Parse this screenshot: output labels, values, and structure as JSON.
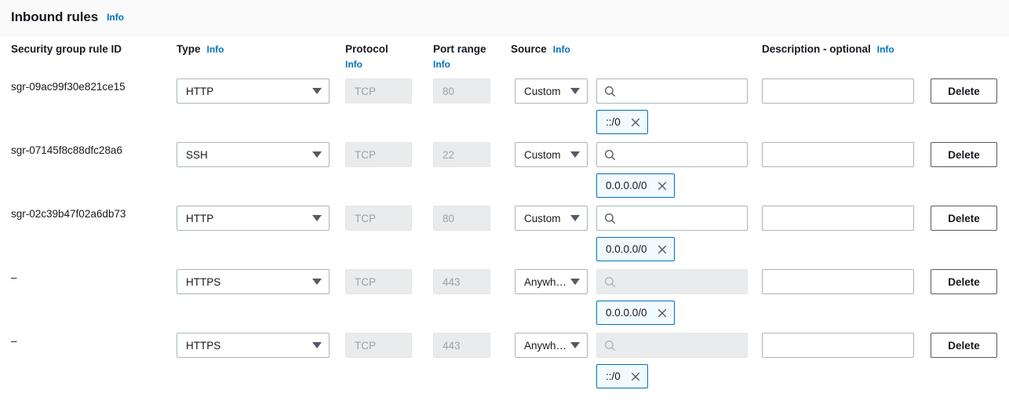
{
  "panel": {
    "title": "Inbound rules",
    "info_label": "Info"
  },
  "columns": {
    "rule_id": "Security group rule ID",
    "type": "Type",
    "type_info": "Info",
    "protocol": "Protocol",
    "protocol_info": "Info",
    "port_range": "Port range",
    "port_range_info": "Info",
    "source": "Source",
    "source_info": "Info",
    "description": "Description - optional",
    "description_info": "Info"
  },
  "icons": {
    "search": "search-icon",
    "close": "close-icon",
    "caret": "chevron-down-icon"
  },
  "colors": {
    "link": "#0073bb",
    "chip_border": "#0073bb",
    "chip_background": "#f1faff",
    "header_background": "#fafafa",
    "disabled_background": "#e9ebed",
    "border": "#aab7b8",
    "text": "#16191f"
  },
  "delete_label": "Delete",
  "rows": [
    {
      "rule_id": "sgr-09ac99f30e821ce15",
      "type": "HTTP",
      "protocol": "TCP",
      "port_range": "80",
      "source_type": "Custom",
      "source_disabled": false,
      "source_value": "",
      "source_token": "::/0",
      "description": ""
    },
    {
      "rule_id": "sgr-07145f8c88dfc28a6",
      "type": "SSH",
      "protocol": "TCP",
      "port_range": "22",
      "source_type": "Custom",
      "source_disabled": false,
      "source_value": "",
      "source_token": "0.0.0.0/0",
      "description": ""
    },
    {
      "rule_id": "sgr-02c39b47f02a6db73",
      "type": "HTTP",
      "protocol": "TCP",
      "port_range": "80",
      "source_type": "Custom",
      "source_disabled": false,
      "source_value": "",
      "source_token": "0.0.0.0/0",
      "description": ""
    },
    {
      "rule_id": "–",
      "type": "HTTPS",
      "protocol": "TCP",
      "port_range": "443",
      "source_type": "Anywh…",
      "source_disabled": true,
      "source_value": "",
      "source_token": "0.0.0.0/0",
      "description": ""
    },
    {
      "rule_id": "–",
      "type": "HTTPS",
      "protocol": "TCP",
      "port_range": "443",
      "source_type": "Anywh…",
      "source_disabled": true,
      "source_value": "",
      "source_token": "::/0",
      "description": ""
    }
  ]
}
